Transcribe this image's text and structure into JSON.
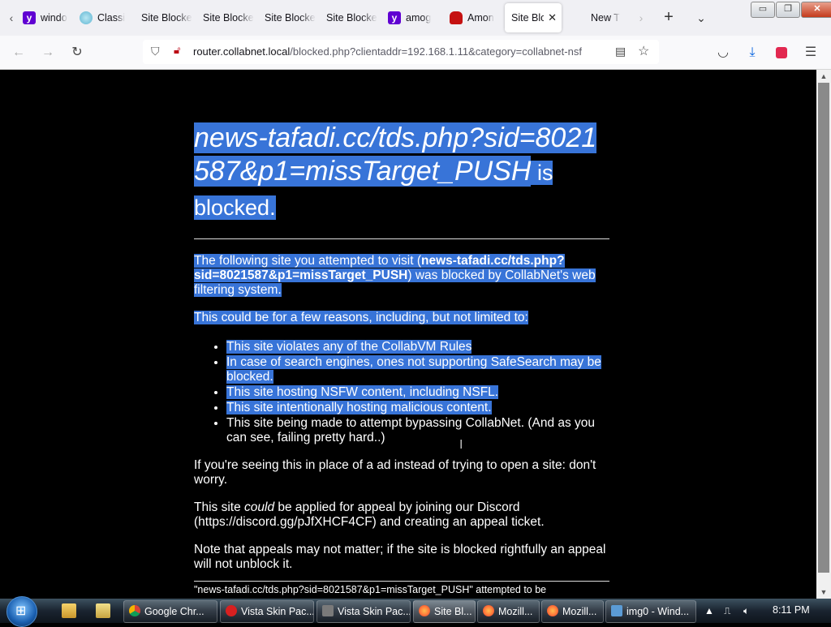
{
  "browser": {
    "tabs": [
      {
        "label": "windo",
        "favicon": "yahoo-icon",
        "color": "#6001d2"
      },
      {
        "label": "Classi",
        "favicon": "globe-icon",
        "color": "#5fb6d3"
      },
      {
        "label": "Site Blocke",
        "favicon": "none",
        "color": ""
      },
      {
        "label": "Site Blocke",
        "favicon": "none",
        "color": ""
      },
      {
        "label": "Site Blocke",
        "favicon": "none",
        "color": ""
      },
      {
        "label": "Site Blocke",
        "favicon": "none",
        "color": ""
      },
      {
        "label": "amog",
        "favicon": "yahoo-icon",
        "color": "#6001d2"
      },
      {
        "label": "Amon",
        "favicon": "among-us-icon",
        "color": "#c51111"
      },
      {
        "label": "Site Blo",
        "favicon": "none",
        "color": "",
        "active": true
      },
      {
        "label": "New T",
        "favicon": "none",
        "color": ""
      }
    ],
    "active_tab_close": "✕",
    "new_tab": "+",
    "list_all_tabs": "⌄",
    "window_controls": {
      "minimize": "▭",
      "maximize": "❐",
      "close": "✕"
    },
    "url": {
      "host": "router.collabnet.local",
      "path": "/blocked.php?clientaddr=192.168.1.11&category=collabnet-nsf"
    }
  },
  "page": {
    "blocked_site": "news-tafadi.cc/tds.php?sid=8021587&p1=missTarget_PUSH",
    "heading_suffix": " is blocked.",
    "intro_before": "The following site you attempted to visit (",
    "intro_site": "news-tafadi.cc/tds.php?sid=8021587&p1=missTarget_PUSH",
    "intro_after": ") was blocked by CollabNet's web filtering system.",
    "reasons_intro": "This could be for a few reasons, including, but not limited to:",
    "reasons": [
      "This site violates any of the CollabVM Rules",
      "In case of search engines, ones not supporting SafeSearch may be blocked.",
      "This site hosting NSFW content, including NSFL.",
      "This site intentionally hosting malicious content.",
      "This site being made to attempt bypassing CollabNet. (And as you can see, failing pretty hard..)"
    ],
    "ad_note": "If you're seeing this in place of a ad instead of trying to open a site: don't worry.",
    "appeal_before": "This site ",
    "appeal_could": "could",
    "appeal_after": " be applied for appeal by joining our Discord (https://discord.gg/pJfXHCF4CF) and creating an appeal ticket.",
    "appeal_note": "Note that appeals may not matter; if the site is blocked rightfully an appeal will not unblock it.",
    "footer": "\"news-tafadi.cc/tds.php?sid=8021587&p1=missTarget_PUSH\" attempted to be"
  },
  "taskbar": {
    "items": [
      {
        "label": "Google Chr...",
        "icon": "chrome-icon",
        "color": "#e8b20c"
      },
      {
        "label": "Vista Skin Pac...",
        "icon": "error-icon",
        "color": "#d82020"
      },
      {
        "label": "Vista Skin Pac...",
        "icon": "installer-icon",
        "color": "#7a7a7a"
      },
      {
        "label": "Site Bl...",
        "icon": "firefox-icon",
        "color": "#ff7139",
        "active": true
      },
      {
        "label": "Mozill...",
        "icon": "firefox-icon",
        "color": "#ff7139"
      },
      {
        "label": "Mozill...",
        "icon": "firefox-icon",
        "color": "#ff7139"
      },
      {
        "label": "img0 - Wind...",
        "icon": "image-viewer-icon",
        "color": "#5b9bd5"
      }
    ],
    "clock": "8:11 PM"
  },
  "colors": {
    "selection": "#3874d8",
    "page_bg": "#000000"
  }
}
